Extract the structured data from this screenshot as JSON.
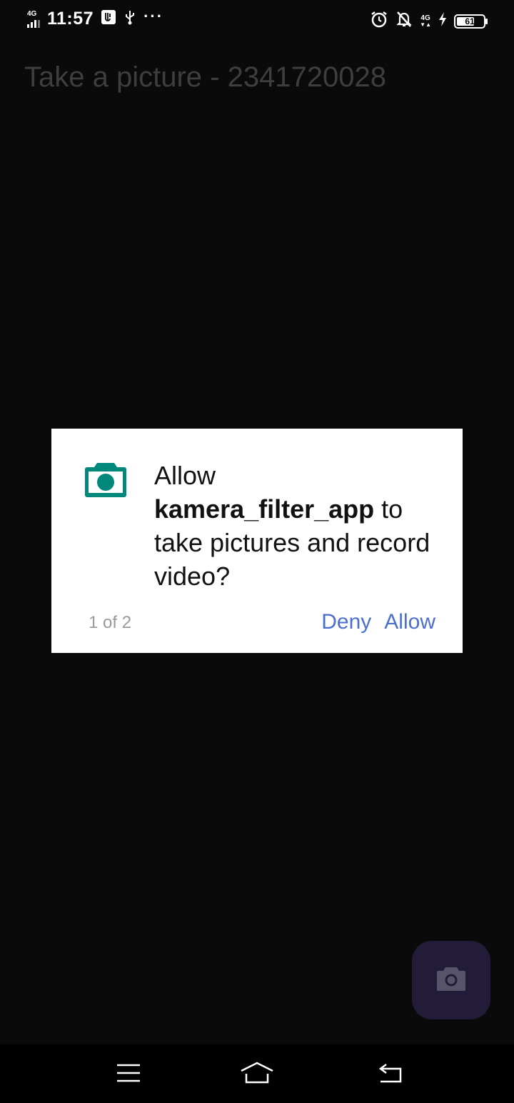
{
  "status_bar": {
    "network_left": "4G",
    "time": "11:57",
    "network_right": "4G",
    "battery_level": "61",
    "battery_fraction": 0.61,
    "icons": [
      "signal-icon",
      "usb-debug-icon",
      "usb-icon",
      "more-notifications-icon",
      "alarm-icon",
      "silent-icon",
      "signal-4g-icon",
      "charging-icon",
      "battery-icon"
    ]
  },
  "app": {
    "title": "Take a picture - 2341720028"
  },
  "dialog": {
    "message_prefix": "Allow ",
    "app_name": "kamera_filter_app",
    "message_suffix": " to take pictures and record video?",
    "counter": "1 of 2",
    "deny_label": "Deny",
    "allow_label": "Allow",
    "icon": "camera-icon",
    "accent_color": "#00897b",
    "button_color": "#4a6fcf"
  },
  "fab": {
    "icon": "camera-icon",
    "background": "#221c38"
  },
  "nav_bar": {
    "icons": [
      "menu-icon",
      "home-icon",
      "back-icon"
    ]
  }
}
